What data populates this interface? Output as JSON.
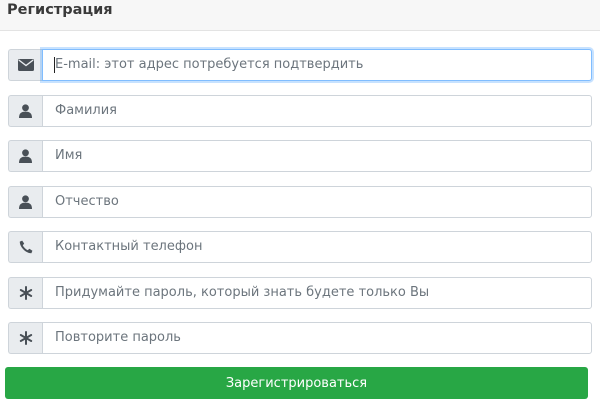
{
  "header": {
    "title": "Регистрация"
  },
  "form": {
    "fields": [
      {
        "icon": "envelope-icon",
        "placeholder": "E-mail: этот адрес потребуется подтвердить"
      },
      {
        "icon": "user-icon",
        "placeholder": "Фамилия"
      },
      {
        "icon": "user-icon",
        "placeholder": "Имя"
      },
      {
        "icon": "user-icon",
        "placeholder": "Отчество"
      },
      {
        "icon": "phone-icon",
        "placeholder": "Контактный телефон"
      },
      {
        "icon": "asterisk-icon",
        "placeholder": "Придумайте пароль, который знать будете только Вы"
      },
      {
        "icon": "asterisk-icon",
        "placeholder": "Повторите пароль"
      }
    ],
    "submit_label": "Зарегистрироваться"
  },
  "colors": {
    "submit": "#28a745",
    "icon": "#495057",
    "focus_border": "#80bdff"
  }
}
